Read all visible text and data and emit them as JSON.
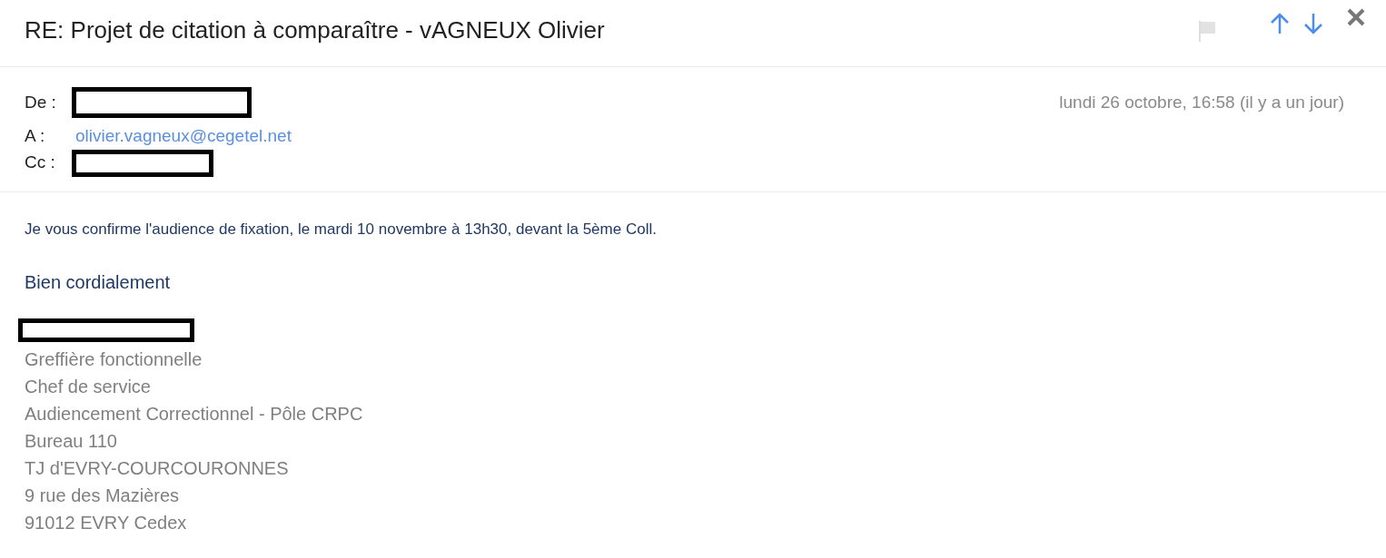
{
  "subject": "RE: Projet de citation à comparaître - vAGNEUX Olivier",
  "header": {
    "from_label": "De :",
    "date": "lundi 26 octobre, 16:58 (il y a un jour)",
    "to_label": "A :",
    "to": "olivier.vagneux@cegetel.net",
    "cc_label": "Cc :"
  },
  "body": {
    "message": "Je vous confirme l'audience de fixation, le mardi 10 novembre à 13h30, devant la 5ème Coll.",
    "closing": "Bien cordialement",
    "signature": [
      "Greffière fonctionnelle",
      "Chef de service",
      "Audiencement Correctionnel - Pôle CRPC",
      "Bureau 110",
      "TJ d'EVRY-COURCOURONNES",
      "9 rue des Mazières",
      "91012 EVRY Cedex"
    ]
  }
}
